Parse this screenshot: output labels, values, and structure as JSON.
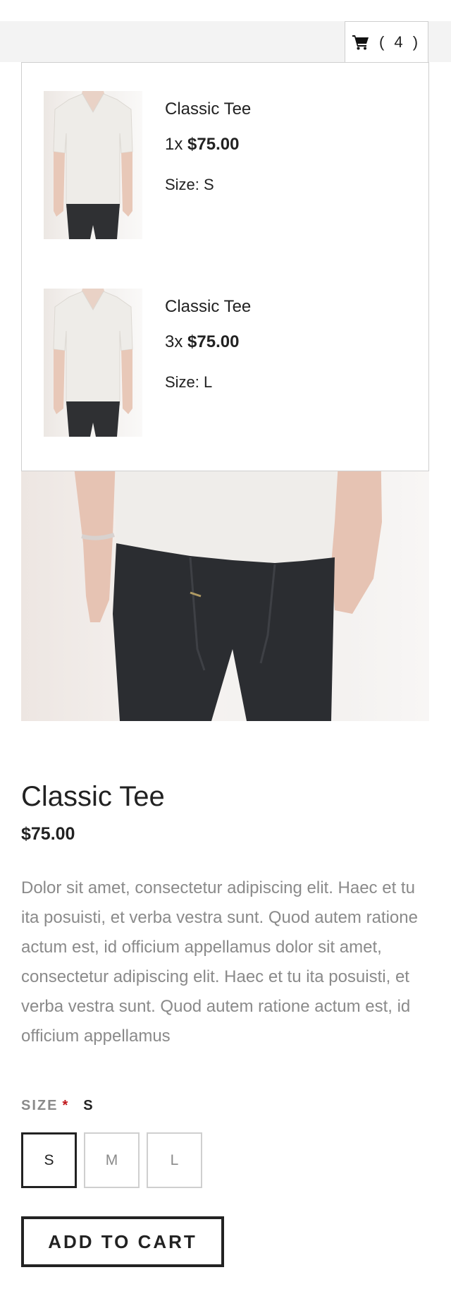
{
  "header": {
    "cart_count_text": "( 4 )"
  },
  "cart": {
    "items": [
      {
        "title": "Classic Tee",
        "quantity": "1x",
        "price": "$75.00",
        "size": "Size: S"
      },
      {
        "title": "Classic Tee",
        "quantity": "3x",
        "price": "$75.00",
        "size": "Size: L"
      }
    ]
  },
  "product": {
    "title": "Classic Tee",
    "price": "$75.00",
    "description": "Dolor sit amet, consectetur adipiscing elit. Haec et tu ita posuisti, et verba vestra sunt. Quod autem ratione actum est, id officium appellamus dolor sit amet, consectetur adipiscing elit. Haec et tu ita posuisti, et verba vestra sunt. Quod autem ratione actum est, id officium appellamus",
    "size_label": "SIZE",
    "required_mark": "*",
    "selected_size": "S",
    "sizes": [
      "S",
      "M",
      "L"
    ],
    "add_to_cart_label": "ADD TO CART"
  },
  "icons": {
    "cart": "shopping-cart-icon"
  },
  "colors": {
    "text": "#222222",
    "muted": "#8a8a8a",
    "border": "#cfcfcf",
    "required": "#c0161b",
    "topbar": "#f3f3f3"
  }
}
